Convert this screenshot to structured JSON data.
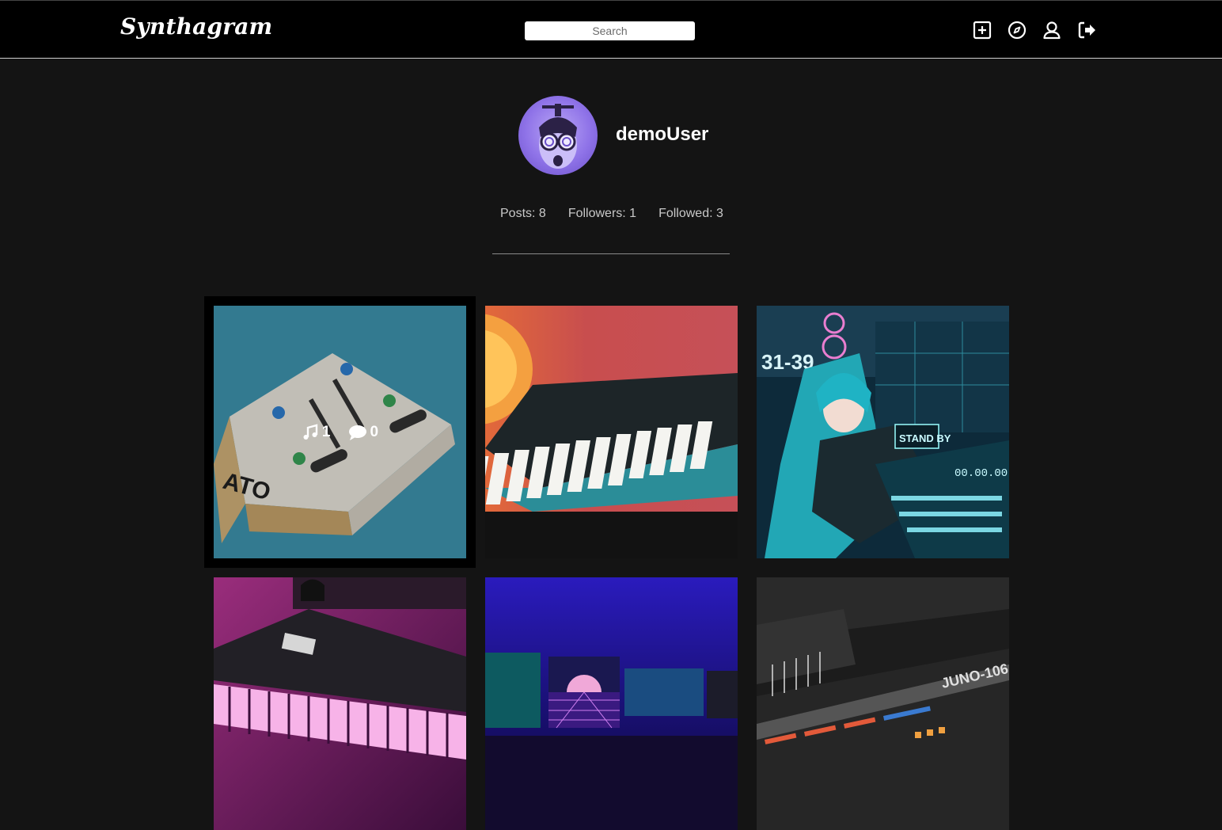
{
  "app": {
    "logo": "Synthagram"
  },
  "search": {
    "placeholder": "Search"
  },
  "nav": {
    "icons": [
      "plus-square-icon",
      "compass-icon",
      "user-icon",
      "sign-out-icon"
    ]
  },
  "profile": {
    "username": "demoUser",
    "avatar_icon": "avatar",
    "stats": {
      "posts": "Posts: 8",
      "followers": "Followers: 1",
      "followed": "Followed: 3"
    }
  },
  "posts": [
    {
      "id": "post-1",
      "hovered": true,
      "likes": "1",
      "comments": "0"
    },
    {
      "id": "post-2"
    },
    {
      "id": "post-3"
    },
    {
      "id": "post-4"
    },
    {
      "id": "post-5"
    },
    {
      "id": "post-6"
    }
  ],
  "colors": {
    "background": "#141414",
    "navbar": "#000000",
    "accent": "#ffffff"
  }
}
